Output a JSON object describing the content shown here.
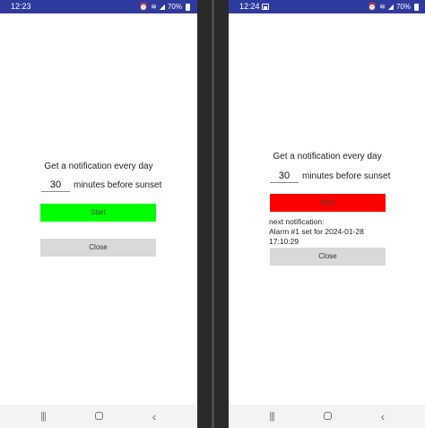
{
  "left_screen": {
    "status_bar": {
      "time": "12:23",
      "icons": [
        "alarm-icon",
        "wifi-calling-icon",
        "signal-icon"
      ],
      "battery": "70%"
    },
    "headline": "Get a notification every day",
    "minutes_value": "30",
    "minutes_label": "minutes before sunset",
    "start_button": "Start",
    "close_button": "Close"
  },
  "right_screen": {
    "status_bar": {
      "time": "12:24",
      "icons": [
        "gallery-icon",
        "alarm-icon",
        "wifi-calling-icon",
        "signal-icon"
      ],
      "battery": "70%"
    },
    "headline": "Get a notification every day",
    "minutes_value": "30",
    "minutes_label": "minutes before sunset",
    "stop_button": "Stop",
    "next_notification": {
      "label": "next notification:",
      "line1": "Alarm #1 set for 2024-01-28",
      "line2": "17:10:29"
    },
    "close_button": "Close"
  },
  "nav_bar": {
    "recents_glyph": "|||",
    "back_glyph": "‹"
  },
  "colors": {
    "status_bar": "#2f3a9e",
    "start_button": "#00ff00",
    "stop_button": "#ff0000",
    "close_button": "#d9d9d9",
    "divider": "#2a2a2a"
  }
}
